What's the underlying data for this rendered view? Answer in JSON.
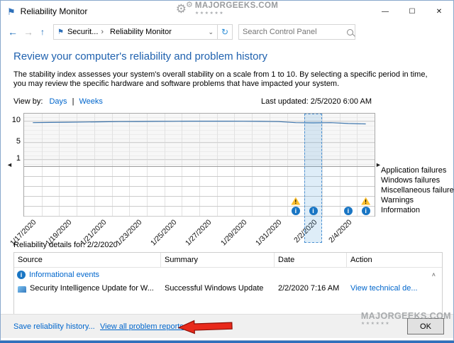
{
  "window": {
    "title": "Reliability Monitor"
  },
  "icons": {
    "app_flag": "⚑",
    "minimize": "—",
    "maximize": "☐",
    "close": "✕",
    "back": "←",
    "forward": "→",
    "up": "↑",
    "breadcrumb_flag": "⚑",
    "breadcrumb_sep": "›",
    "dropdown": "⌄",
    "refresh": "↻",
    "left_scroll": "◄",
    "right_scroll": "►",
    "collapse": "˄",
    "info_glyph": "i",
    "warning_glyph": "!"
  },
  "watermarks": {
    "top_text": "MAJORGEEKS.COM",
    "top_stars": "★★★★★★",
    "bottom_text": "MAJORGEEKS.COM",
    "bottom_stars": "★★★★★★",
    "gear": "⚙"
  },
  "toolbar": {
    "breadcrumb_root": "Securit...",
    "breadcrumb_current": "Reliability Monitor",
    "search_placeholder": "Search Control Panel"
  },
  "main": {
    "heading": "Review your computer's reliability and problem history",
    "description": "The stability index assesses your system's overall stability on a scale from 1 to 10. By selecting a specific period in time, you may review the specific hardware and software problems that have impacted your system.",
    "view_by": "View by:",
    "days": "Days",
    "divider": "|",
    "weeks": "Weeks",
    "last_updated": "Last updated: 2/5/2020 6:00 AM"
  },
  "chart_data": {
    "type": "line",
    "title": "System stability chart",
    "y_ticks": [
      "10",
      "5",
      "1"
    ],
    "ylim": [
      1,
      10
    ],
    "days": 20,
    "start_date": "1/17/2020",
    "end_date": "2/5/2020",
    "x_labels": [
      "1/17/2020",
      "1/19/2020",
      "1/21/2020",
      "1/23/2020",
      "1/25/2020",
      "1/27/2020",
      "1/29/2020",
      "1/31/2020",
      "2/2/2020",
      "2/4/2020"
    ],
    "x_label_columns": [
      0,
      2,
      4,
      6,
      8,
      10,
      12,
      14,
      16,
      18
    ],
    "stability": [
      9.55,
      9.6,
      9.65,
      9.7,
      9.75,
      9.8,
      9.82,
      9.85,
      9.87,
      9.9,
      9.9,
      9.9,
      9.88,
      9.85,
      9.8,
      9.55,
      9.5,
      9.55,
      9.35,
      9.25
    ],
    "selected_column": 16,
    "selected_date": "2/2/2020",
    "rows": [
      "Application failures",
      "Windows failures",
      "Miscellaneous failures",
      "Warnings",
      "Information"
    ],
    "info_columns": [
      15,
      16,
      18,
      19
    ],
    "warning_columns": [
      15,
      19
    ],
    "legend_position": "right",
    "grid": true
  },
  "details": {
    "title": "Reliability details for: 2/2/2020",
    "columns": [
      "Source",
      "Summary",
      "Date",
      "Action"
    ],
    "group_label": "Informational events",
    "rows": [
      {
        "source": "Security Intelligence Update for W...",
        "summary": "Successful Windows Update",
        "date": "2/2/2020 7:16 AM",
        "action": "View technical de..."
      }
    ]
  },
  "footer": {
    "save_link": "Save reliability history...",
    "view_link": "View all problem reports",
    "ok": "OK"
  }
}
